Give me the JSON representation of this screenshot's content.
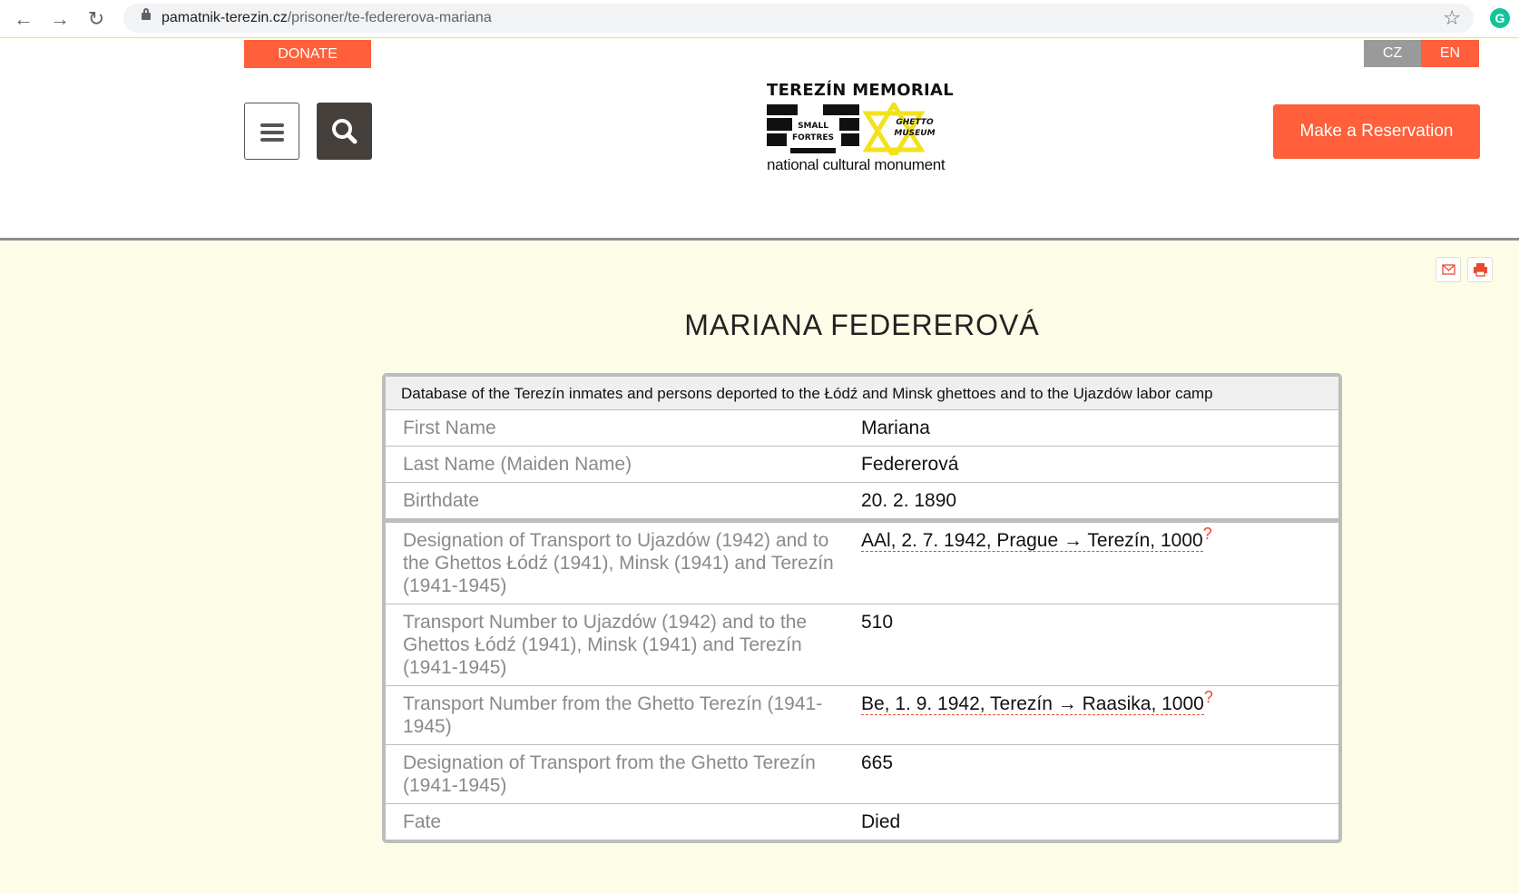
{
  "browser": {
    "url_domain": "pamatnik-terezin.cz",
    "url_path": "/prisoner/te-federerova-mariana",
    "extension_letter": "G"
  },
  "header": {
    "donate_label": "DONATE",
    "lang_cz": "CZ",
    "lang_en": "EN",
    "reserve_label": "Make a Reservation",
    "logo": {
      "title": "TEREZÍN MEMORIAL",
      "small_fortress": "SMALL FORTRES",
      "ghetto_museum": "GHETTO MUSEUM",
      "subtitle": "national cultural monument"
    }
  },
  "page": {
    "title": "MARIANA FEDEREROVÁ",
    "table_header": "Database of the Terezín inmates and persons deported to the Łódź and Minsk ghettoes and to the Ujazdów labor camp",
    "rows": [
      {
        "label": "First Name",
        "value": "Mariana"
      },
      {
        "label": "Last Name (Maiden Name)",
        "value": "Federerová"
      },
      {
        "label": "Birthdate",
        "value": "20. 2. 1890"
      },
      {
        "label": "Designation of Transport to Ujazdów (1942) and to the Ghettos Łódź (1941), Minsk (1941) and Terezín (1941-1945)",
        "value": "AAl, 2. 7. 1942, Prague → Terezín, 1000",
        "help": "?"
      },
      {
        "label": "Transport Number to Ujazdów (1942) and to the Ghettos Łódź (1941), Minsk (1941) and Terezín (1941-1945)",
        "value": "510"
      },
      {
        "label": "Transport Number from the Ghetto Terezín (1941-1945)",
        "value": "Be, 1. 9. 1942, Terezín → Raasika, 1000",
        "help": "?"
      },
      {
        "label": "Designation of Transport from the Ghetto Terezín (1941-1945)",
        "value": "665"
      },
      {
        "label": "Fate",
        "value": "Died"
      }
    ]
  },
  "colors": {
    "accent": "#ff5f3a",
    "page_bg": "#fdfde7",
    "dark_button": "#45403c"
  }
}
